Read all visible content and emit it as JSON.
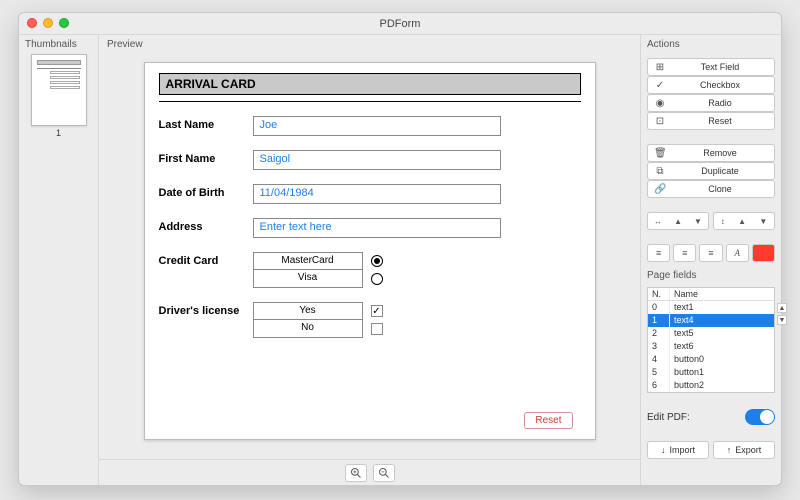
{
  "window": {
    "title": "PDForm"
  },
  "thumbnails": {
    "label": "Thumbnails",
    "page_number": "1"
  },
  "preview": {
    "label": "Preview"
  },
  "form": {
    "title": "ARRIVAL CARD",
    "fields": {
      "last_name": {
        "label": "Last Name",
        "value": "Joe"
      },
      "first_name": {
        "label": "First Name",
        "value": "Saigol"
      },
      "dob": {
        "label": "Date of Birth",
        "value": "11/04/1984"
      },
      "address": {
        "label": "Address",
        "value": "Enter text here"
      }
    },
    "credit_card": {
      "label": "Credit Card",
      "options": [
        "MasterCard",
        "Visa"
      ],
      "selected": "MasterCard"
    },
    "license": {
      "label": "Driver's license",
      "options": [
        "Yes",
        "No"
      ],
      "checked": "Yes"
    },
    "reset_label": "Reset"
  },
  "actions": {
    "label": "Actions",
    "group1": [
      {
        "icon": "⊞",
        "label": "Text Field"
      },
      {
        "icon": "✓",
        "label": "Checkbox"
      },
      {
        "icon": "◉",
        "label": "Radio"
      },
      {
        "icon": "⊡",
        "label": "Reset"
      }
    ],
    "group2": [
      {
        "icon": "🗑",
        "label": "Remove"
      },
      {
        "icon": "⧉",
        "label": "Duplicate"
      },
      {
        "icon": "🔗",
        "label": "Clone"
      }
    ],
    "page_fields": {
      "label": "Page fields",
      "columns": [
        "N.",
        "Name"
      ],
      "rows": [
        {
          "n": "0",
          "name": "text1",
          "selected": false
        },
        {
          "n": "1",
          "name": "text4",
          "selected": true
        },
        {
          "n": "2",
          "name": "text5",
          "selected": false
        },
        {
          "n": "3",
          "name": "text6",
          "selected": false
        },
        {
          "n": "4",
          "name": "button0",
          "selected": false
        },
        {
          "n": "5",
          "name": "button1",
          "selected": false
        },
        {
          "n": "6",
          "name": "button2",
          "selected": false
        }
      ]
    },
    "edit_pdf": {
      "label": "Edit PDF:",
      "on": true
    },
    "import_label": "Import",
    "export_label": "Export",
    "color_swatch": "#ff3b2f"
  }
}
